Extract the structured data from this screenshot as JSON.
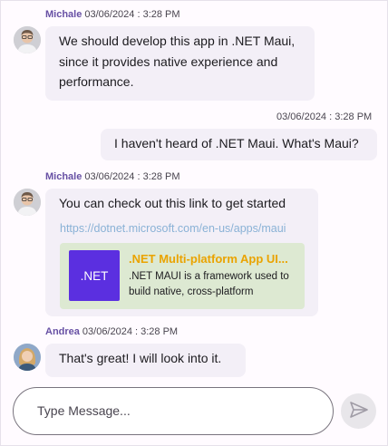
{
  "messages": [
    {
      "author": "Michale",
      "timestamp": "03/06/2024 : 3:28 PM",
      "avatar_icon": "male-avatar",
      "lines": [
        "We should develop this app in .NET Maui,",
        "since it provides native experience and",
        "performance."
      ]
    },
    {
      "author": "",
      "timestamp": "03/06/2024 : 3:28 PM",
      "lines": [
        "I haven't heard of .NET Maui. What's Maui?"
      ]
    },
    {
      "author": "Michale",
      "timestamp": "03/06/2024 : 3:28 PM",
      "avatar_icon": "male-avatar",
      "lines": [
        "You can check out this link to get started"
      ],
      "link": "https://dotnet.microsoft.com/en-us/apps/maui",
      "preview": {
        "thumb_text": ".NET",
        "title": ".NET Multi-platform App UI...",
        "desc_lines": [
          ".NET MAUI is a framework used to",
          "build native, cross-platform"
        ]
      }
    },
    {
      "author": "Andrea",
      "timestamp": "03/06/2024 : 3:28 PM",
      "avatar_icon": "female-avatar",
      "lines": [
        "That's great! I will look into it."
      ]
    }
  ],
  "composer": {
    "placeholder": "Type Message...",
    "send_icon": "send-icon"
  },
  "colors": {
    "author": "#6750a4",
    "bubble": "#f3eff7",
    "link": "#8ab2d6",
    "preview_bg": "#dde9d2",
    "preview_title": "#eaa300",
    "preview_thumb": "#5b2fe0"
  }
}
